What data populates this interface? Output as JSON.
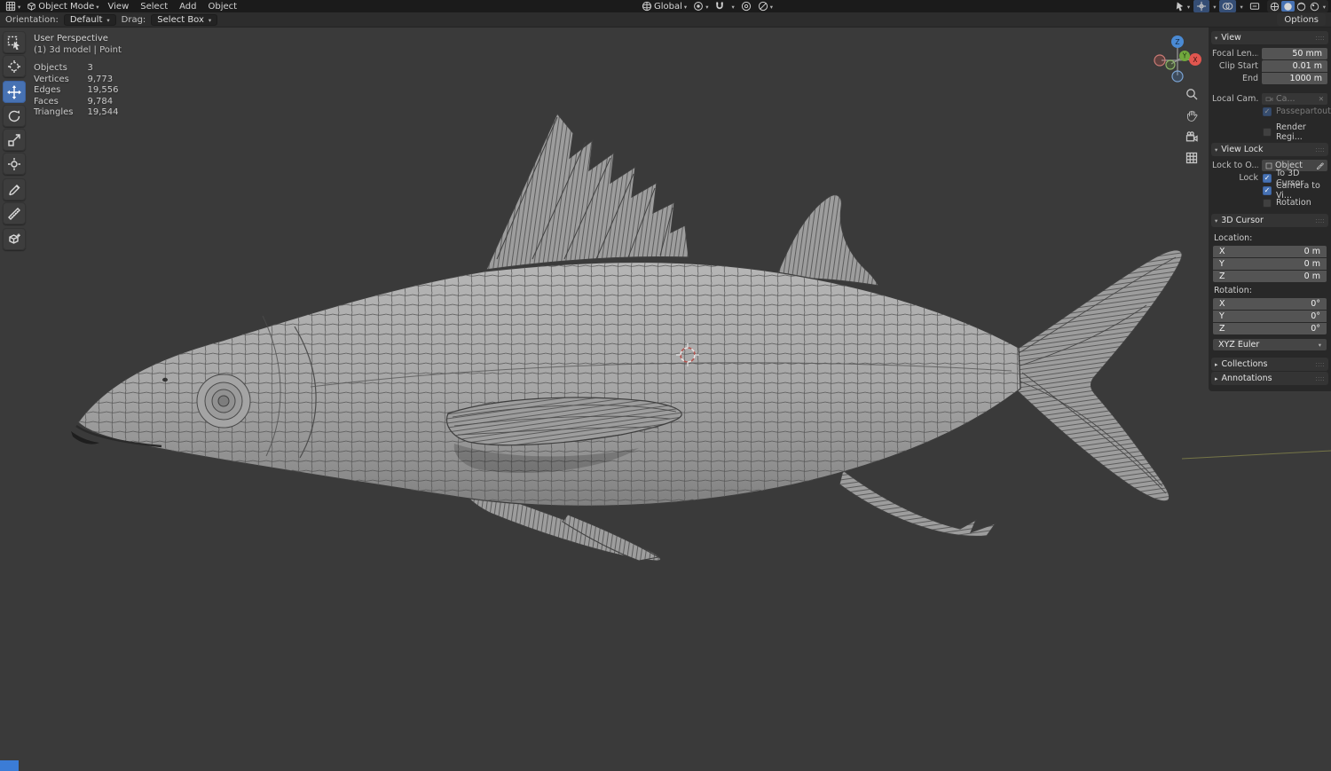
{
  "colors": {
    "accent": "#4772b3",
    "header_bg": "#1b1b1b",
    "toolsettings_bg": "#2d2d2d",
    "viewport_bg": "#3a3a3a",
    "field_bg": "#545454",
    "axis_x": "#e0564f",
    "axis_y": "#71a83d",
    "axis_z": "#4a8ad4",
    "model_gray": "#a6a6a6",
    "wire_gray": "#565656"
  },
  "header": {
    "mode_label": "Object Mode",
    "menu_view": "View",
    "menu_select": "Select",
    "menu_add": "Add",
    "menu_object": "Object",
    "orientation_value": "Global",
    "active_shading": "solid"
  },
  "toolsettings": {
    "orientation_label": "Orientation:",
    "orientation_value": "Default",
    "drag_label": "Drag:",
    "drag_value": "Select Box",
    "options_label": "Options"
  },
  "toolbar": {
    "active_tool": "move"
  },
  "viewport": {
    "perspective_label": "User Perspective",
    "scene_label": "(1) 3d model | Point",
    "stats": {
      "rows": [
        {
          "label": "Objects",
          "value": "3"
        },
        {
          "label": "Vertices",
          "value": "9,773"
        },
        {
          "label": "Edges",
          "value": "19,556"
        },
        {
          "label": "Faces",
          "value": "9,784"
        },
        {
          "label": "Triangles",
          "value": "19,544"
        }
      ]
    },
    "gizmo": {
      "x": "X",
      "y": "Y",
      "z": "Z"
    }
  },
  "npanel": {
    "view": {
      "title": "View",
      "focal_label": "Focal Len...",
      "focal_value": "50 mm",
      "clip_start_label": "Clip Start",
      "clip_start_value": "0.01 m",
      "clip_end_label": "End",
      "clip_end_value": "1000 m",
      "local_cam_label": "Local Cam...",
      "local_cam_value": "Ca...",
      "passepartout_label": "Passepartout",
      "passepartout_checked": true,
      "render_region_label": "Render Regi...",
      "render_region_checked": false
    },
    "view_lock": {
      "title": "View Lock",
      "lock_to_label": "Lock to O...",
      "lock_to_value": "Object",
      "lock_label": "Lock",
      "to_3d_cursor_label": "To 3D Cursor",
      "to_3d_cursor_checked": true,
      "camera_to_view_label": "Camera to Vi...",
      "camera_to_view_checked": true,
      "rotation_label": "Rotation",
      "rotation_checked": false
    },
    "cursor3d": {
      "title": "3D Cursor",
      "location_label": "Location:",
      "location": [
        {
          "axis": "X",
          "value": "0 m"
        },
        {
          "axis": "Y",
          "value": "0 m"
        },
        {
          "axis": "Z",
          "value": "0 m"
        }
      ],
      "rotation_label": "Rotation:",
      "rotation": [
        {
          "axis": "X",
          "value": "0°"
        },
        {
          "axis": "Y",
          "value": "0°"
        },
        {
          "axis": "Z",
          "value": "0°"
        }
      ],
      "euler_value": "XYZ Euler"
    },
    "collections_title": "Collections",
    "annotations_title": "Annotations"
  }
}
